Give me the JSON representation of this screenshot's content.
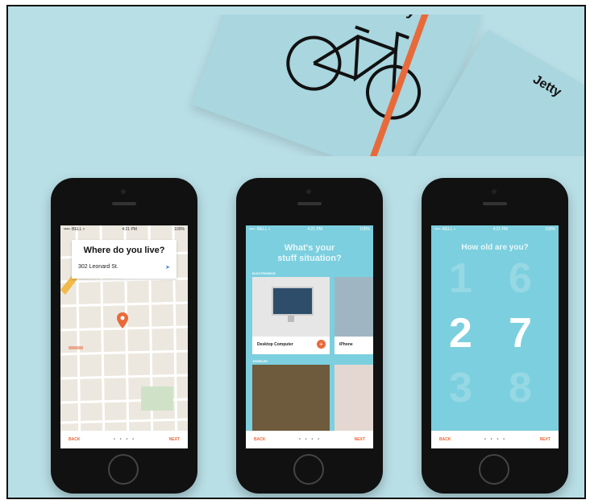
{
  "book": {
    "brand": "Jetty"
  },
  "phone1": {
    "status": {
      "carrier": "••••◦ BELL ▿",
      "time": "4:21 PM",
      "battery": "100%"
    },
    "question": "Where do you live?",
    "address": "302 Leonard St.",
    "back_label": "BACK",
    "next_label": "NEXT",
    "dots": "• • • •"
  },
  "phone2": {
    "status": {
      "carrier": "••••◦ BELL ▿",
      "time": "4:21 PM",
      "battery": "100%"
    },
    "title_line1": "What's your",
    "title_line2": "stuff situation?",
    "section1": "ELECTRONICS",
    "section2": "JEWELRY",
    "items": [
      {
        "label": "Desktop Computer",
        "add": "+"
      },
      {
        "label": "iPhone"
      }
    ],
    "back_label": "BACK",
    "next_label": "NEXT",
    "dots": "• • • •"
  },
  "phone3": {
    "status": {
      "carrier": "••••◦ BELL ▿",
      "time": "4:21 PM",
      "battery": "100%"
    },
    "question": "How old are you?",
    "picker": {
      "top": [
        "1",
        "6"
      ],
      "selected": [
        "2",
        "7"
      ],
      "bottom": [
        "3",
        "8"
      ]
    },
    "back_label": "BACK",
    "next_label": "NEXT",
    "dots": "• • • •"
  },
  "colors": {
    "background": "#b9dfe6",
    "accent": "#e86a3b",
    "teal": "#7ccfde"
  }
}
